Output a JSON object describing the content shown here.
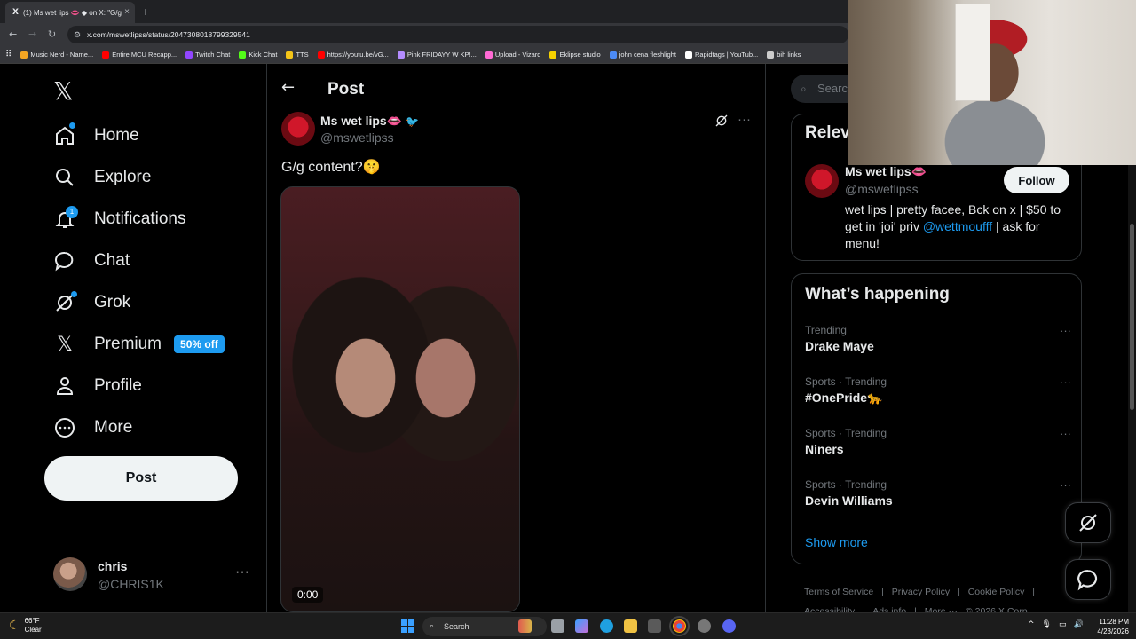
{
  "browser": {
    "tab_title": "(1) Ms wet lips 👄 ◆ on X: \"G/g",
    "tab_close": "×",
    "new_tab": "+",
    "url": "x.com/mswetlipss/status/2047308018799329541",
    "bookmarks": [
      {
        "label": "Music Nerd - Name...",
        "color": "#f5a623"
      },
      {
        "label": "Entire MCU Recapp...",
        "color": "#ff0000"
      },
      {
        "label": "Twitch Chat",
        "color": "#9146ff"
      },
      {
        "label": "Kick Chat",
        "color": "#53fc18"
      },
      {
        "label": "TTS",
        "color": "#f5c518"
      },
      {
        "label": "https://youtu.be/vG...",
        "color": "#ff0000"
      },
      {
        "label": "Pink FRIDAYY W KP!...",
        "color": "#b48cff"
      },
      {
        "label": "Upload - Vizard",
        "color": "#ff6ad5"
      },
      {
        "label": "Eklipse studio",
        "color": "#f5d000"
      },
      {
        "label": "john cena fleshlight",
        "color": "#4c8bf5"
      },
      {
        "label": "Rapidtags | YouTub...",
        "color": "#ffffff"
      },
      {
        "label": "bih links",
        "color": "#cccccc"
      }
    ]
  },
  "sidebar": {
    "logo": "𝕏",
    "items": [
      {
        "label": "Home",
        "icon": "home-icon"
      },
      {
        "label": "Explore",
        "icon": "search-icon"
      },
      {
        "label": "Notifications",
        "icon": "bell-icon",
        "badge": "1"
      },
      {
        "label": "Chat",
        "icon": "chat-icon"
      },
      {
        "label": "Grok",
        "icon": "grok-icon"
      },
      {
        "label": "Premium",
        "icon": "x-icon",
        "pill": "50% off"
      },
      {
        "label": "Profile",
        "icon": "person-icon"
      },
      {
        "label": "More",
        "icon": "more-circle-icon"
      }
    ],
    "post_button": "Post",
    "account": {
      "name": "chris",
      "handle": "@CHRIS1K",
      "more": "···"
    }
  },
  "main": {
    "header_title": "Post",
    "post": {
      "author_name": "Ms wet lips👄",
      "author_handle": "@mswetlipss",
      "text": "G/g content?🤫",
      "video_time": "0:00"
    }
  },
  "right": {
    "search_placeholder": "Searc",
    "relevant": {
      "title": "Relev",
      "name": "Ms wet lips👄",
      "handle": "@mswetlipss",
      "follow_label": "Follow",
      "bio_prefix": "wet lips | pretty facee, Bck on x | $50 to get in 'joi' priv ",
      "bio_link": "@wettmoufff",
      "bio_suffix": " | ask for menu!"
    },
    "happening": {
      "title": "What’s happening",
      "trends": [
        {
          "meta": "Trending",
          "name": "Drake Maye"
        },
        {
          "meta": "Sports · Trending",
          "name": "#OnePride🐆"
        },
        {
          "meta": "Sports · Trending",
          "name": "Niners"
        },
        {
          "meta": "Sports · Trending",
          "name": "Devin Williams"
        }
      ],
      "show_more": "Show more"
    },
    "footer": {
      "line1": [
        "Terms of Service",
        "|",
        "Privacy Policy",
        "|",
        "Cookie Policy",
        "|"
      ],
      "line2": [
        "Accessibility",
        "|",
        "Ads info",
        "|",
        "More ···",
        "© 2026 X Corp."
      ]
    }
  },
  "taskbar": {
    "weather_temp": "66°F",
    "weather_desc": "Clear",
    "search_label": "Search",
    "time": "11:28 PM",
    "date": "4/23/2026"
  },
  "colors": {
    "accent": "#1d9bf0",
    "background": "#000000"
  }
}
